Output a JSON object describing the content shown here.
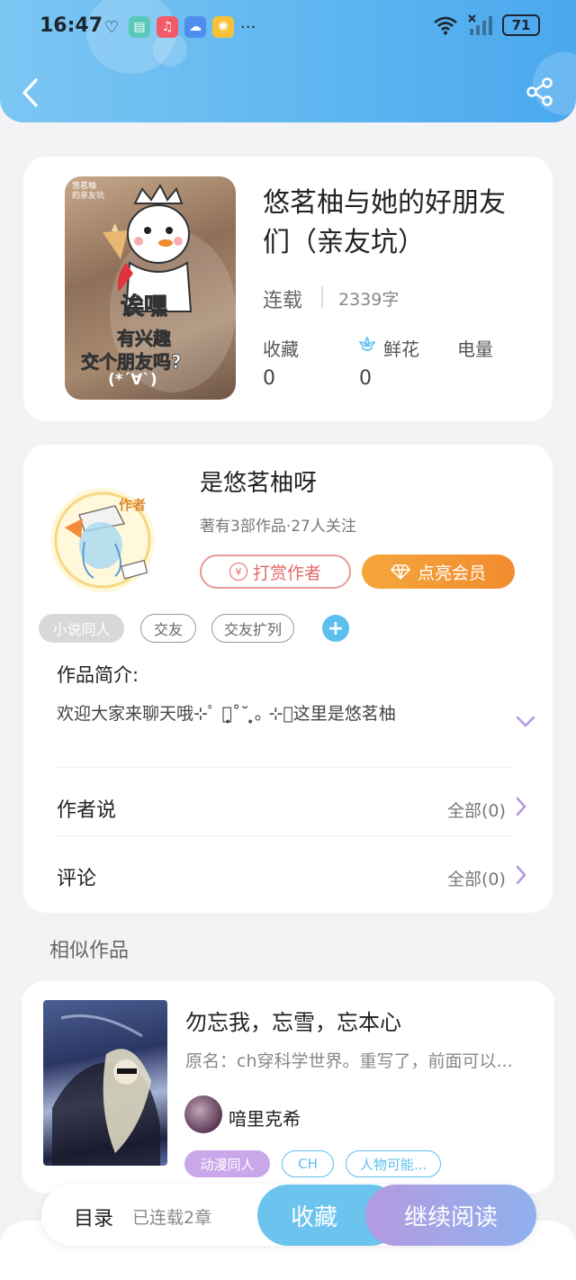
{
  "status_bar": {
    "time": "16:47",
    "battery": "71",
    "more": "···"
  },
  "book": {
    "title": "悠茗柚与她的好朋友们（亲友坑）",
    "status": "连载",
    "word_count": "2339字",
    "cover_text": {
      "line1": "悠茗柚",
      "line2": "的亲友坑",
      "line3": "诶嘿",
      "line4": "有兴趣",
      "line5": "交个朋友吗?",
      "line6": "(*´∀`)"
    },
    "stats": [
      {
        "label": "收藏",
        "value": "0"
      },
      {
        "label": "鲜花",
        "value": "0"
      },
      {
        "label": "电量",
        "value": ""
      }
    ]
  },
  "author": {
    "name": "是悠茗柚呀",
    "meta": "著有3部作品·27人关注",
    "badge": "作者",
    "tip_button": "打赏作者",
    "tip_icon": "¥",
    "vip_button": "点亮会员"
  },
  "tags": [
    "小说同人",
    "交友",
    "交友扩列"
  ],
  "intro": {
    "title": "作品简介:",
    "text": "欢迎大家来聊天哦⊹ﾟ ｡̩̥˚˘ ̩̥｡ ⊹ﾟ这里是悠茗柚"
  },
  "rows": [
    {
      "label": "作者说",
      "all": "全部(0)"
    },
    {
      "label": "评论",
      "all": "全部(0)"
    }
  ],
  "similar": {
    "section_title": "相似作品",
    "title": "勿忘我，忘雪，忘本心",
    "desc": "原名：ch穿科学世界。重写了，前面可以...",
    "author": "喑里克希",
    "tags": [
      "动漫同人",
      "CH",
      "人物可能..."
    ]
  },
  "bottom_bar": {
    "toc": "目录",
    "chapters": "已连载2章",
    "favorite": "收藏",
    "continue": "继续阅读"
  },
  "colors": {
    "header_blue": "#5fb6f0",
    "vip_orange": "#f28c2f",
    "tip_red": "#e26868",
    "chevron_purple": "#b49ae0",
    "tag_blue": "#5cc0ee",
    "tag_purple": "#c9a7ea"
  }
}
